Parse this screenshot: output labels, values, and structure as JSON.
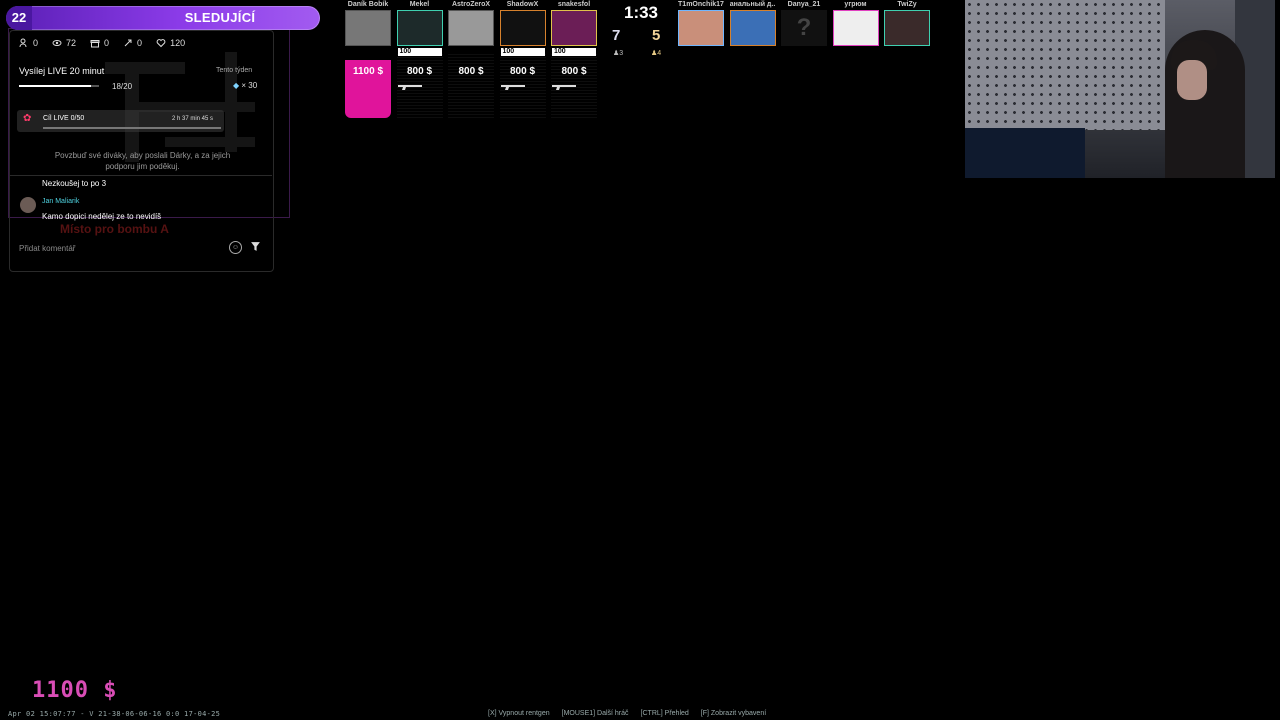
{
  "follow_bar": {
    "count": "22",
    "label": "SLEDUJÍCÍ",
    "tag": ""
  },
  "stream": {
    "stats": {
      "users": "0",
      "views": "72",
      "gifts": "0",
      "boost": "0",
      "likes": "120"
    },
    "live_title": "Vysílej LIVE 20 minut",
    "week_label": "Tento týden",
    "progress_text": "18/20",
    "progress_fraction": 0.9,
    "gem_count": "× 30",
    "goal_label": "Cíl LIVE 0/50",
    "goal_time": "2 h 37 min 45 s",
    "encourage": "Povzbuď své diváky, aby poslali Dárky, a za jejich podporu jim poděkuj.",
    "chat": [
      {
        "name": "",
        "text": "Nezkoušej to po 3"
      },
      {
        "name": "Jan Maliarik",
        "text": "Kamo dopici nedělej ze to nevidíš"
      }
    ],
    "map_callout": "Místo pro bombu A",
    "comment_placeholder": "Přidat komentář"
  },
  "scoreboard": {
    "timer": "1:33",
    "score_ct": "7",
    "score_t": "5",
    "alive_ct": "♟3",
    "alive_t": "♟4",
    "left_team": [
      {
        "name": "Daník Bobík",
        "hp": "",
        "money": "1100 $",
        "highlight": "#e0149b",
        "photo_color": "#777",
        "weapon": false
      },
      {
        "name": "Mekel",
        "hp": "100",
        "money": "800 $",
        "highlight": "",
        "photo_color": "#1d2a2a",
        "border": "#3fd0b0",
        "weapon": true
      },
      {
        "name": "AstroZeroX",
        "hp": "",
        "money": "800 $",
        "highlight": "",
        "photo_color": "#999",
        "weapon": false
      },
      {
        "name": "ShadowX",
        "hp": "100",
        "money": "800 $",
        "highlight": "",
        "photo_color": "#111",
        "border": "#d6812d",
        "weapon": true
      },
      {
        "name": "snakesfol",
        "hp": "100",
        "money": "800 $",
        "highlight": "",
        "photo_color": "#6b1e56",
        "border": "#e0c24a",
        "weapon": true
      }
    ],
    "right_team": [
      {
        "name": "T1mOnchik17",
        "photo_color": "#c98f7a",
        "border": "#6fb6ff"
      },
      {
        "name": "анальный д..",
        "photo_color": "#3b6fb6",
        "border": "#d6812d"
      },
      {
        "name": "Danya_21",
        "photo_color": "#111",
        "border": "",
        "unknown": "?"
      },
      {
        "name": "угрюм",
        "photo_color": "#eee",
        "border": "#e040c0"
      },
      {
        "name": "TwiZy",
        "photo_color": "#3a2a2a",
        "border": "#3fd0b0"
      }
    ]
  },
  "bottom": {
    "money": "1100 $",
    "demo_info": "Apr 02 15:07:77 - V 21-38-06-06-16 0:0 17-04-25",
    "hints": [
      "[X] Vypnout rentgen",
      "[MOUSE1] Další hráč",
      "[CTRL] Přehled",
      "[F] Zobrazit vybavení"
    ]
  }
}
